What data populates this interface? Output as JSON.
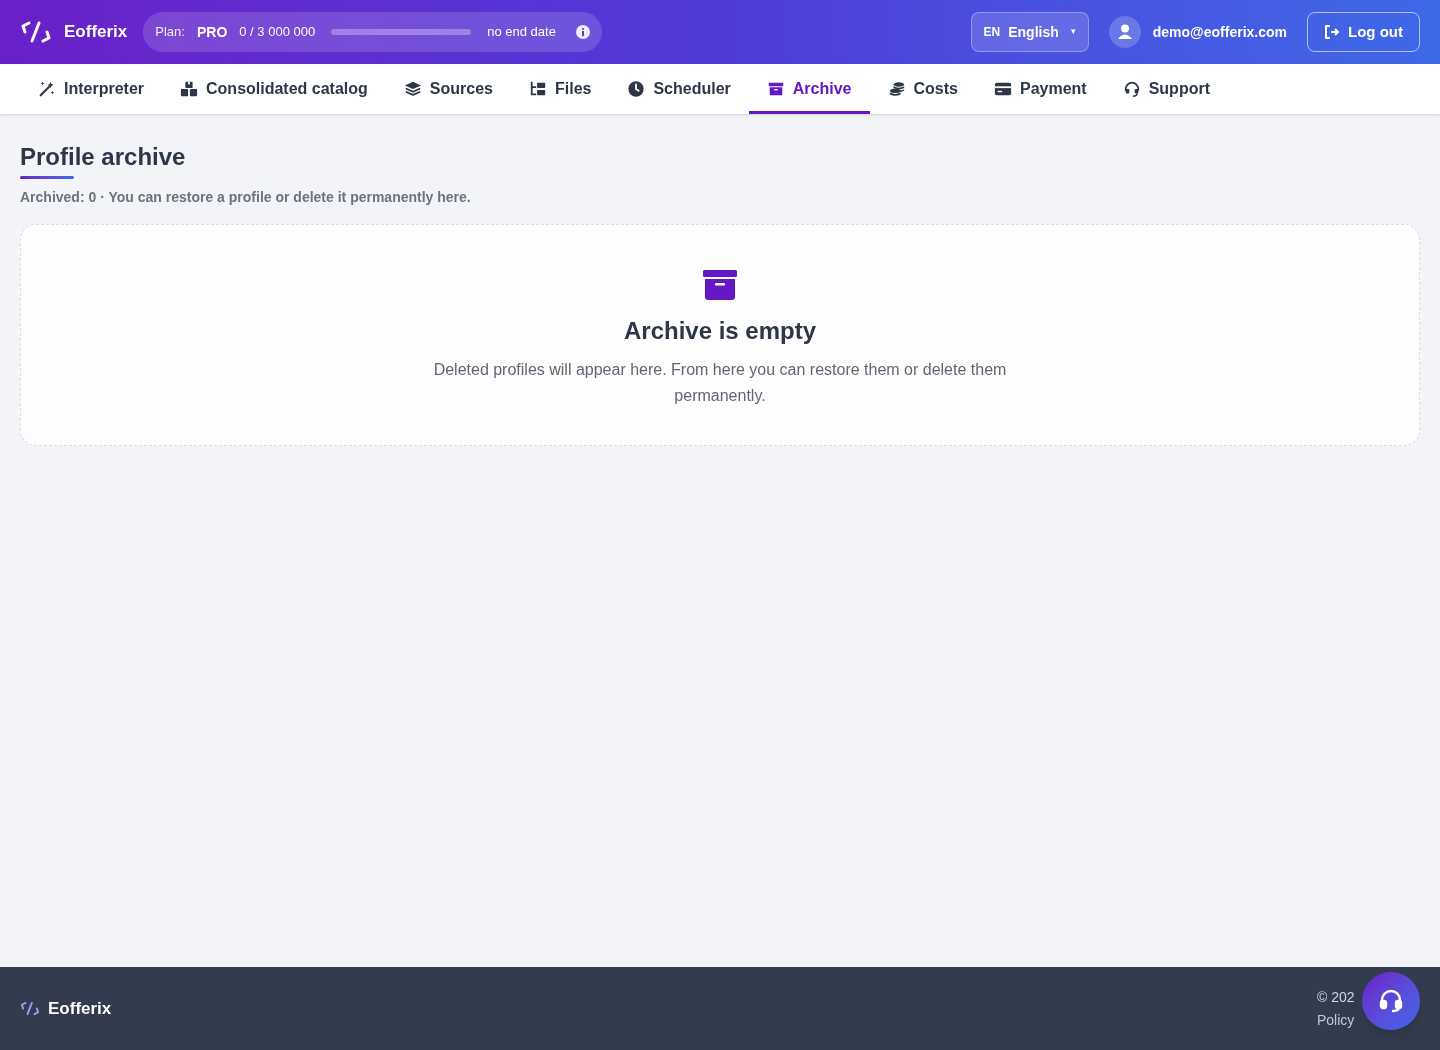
{
  "header": {
    "brand": "Eofferix",
    "plan": {
      "label": "Plan:",
      "name": "PRO",
      "usage": "0 / 3 000 000",
      "level": 0,
      "end": "no end date"
    },
    "language": {
      "code": "EN",
      "name": "English",
      "caret": "▾"
    },
    "user": "demo@eofferix.com",
    "logout": "Log out"
  },
  "tabs": [
    {
      "label": "Interpreter",
      "kind": "wand",
      "selected": false
    },
    {
      "label": "Consolidated catalog",
      "kind": "boxes",
      "selected": false
    },
    {
      "label": "Sources",
      "kind": "layers",
      "selected": false
    },
    {
      "label": "Files",
      "kind": "tree",
      "selected": false
    },
    {
      "label": "Scheduler",
      "kind": "clock",
      "selected": false
    },
    {
      "label": "Archive",
      "kind": "archive",
      "selected": true
    },
    {
      "label": "Costs",
      "kind": "coins",
      "selected": false
    },
    {
      "label": "Payment",
      "kind": "card",
      "selected": false
    },
    {
      "label": "Support",
      "kind": "headset",
      "selected": false
    }
  ],
  "page": {
    "title": "Profile archive",
    "subtitle": "Archived: 0 · You can restore a profile or delete it permanently here.",
    "empty": {
      "title": "Archive is empty",
      "text": "Deleted profiles will appear here. From here you can restore them or delete them permanently."
    }
  },
  "footer": {
    "brand": "Eofferix",
    "copyright": "© 202",
    "link": "Policy"
  }
}
